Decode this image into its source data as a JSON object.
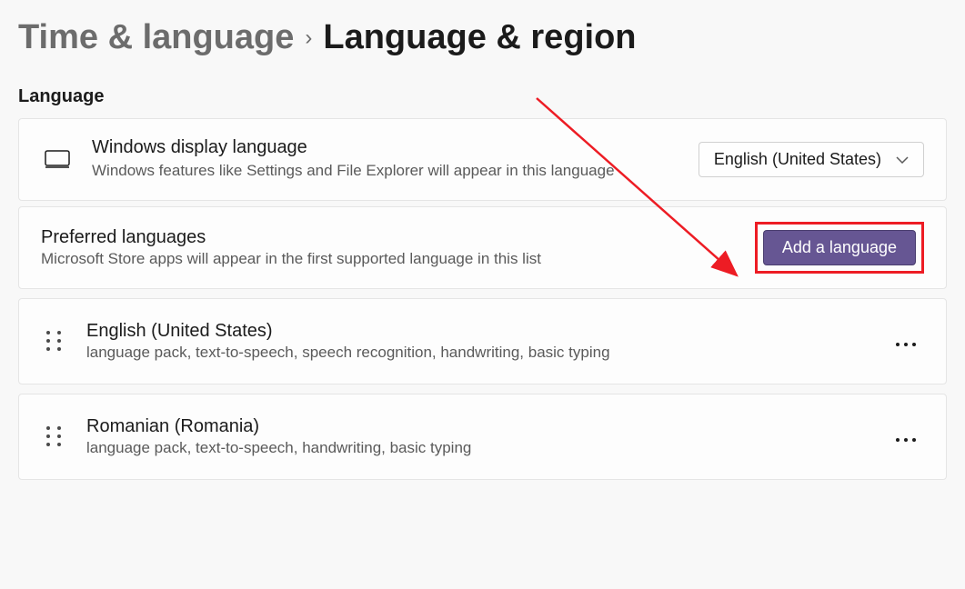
{
  "breadcrumb": {
    "parent": "Time & language",
    "current": "Language & region"
  },
  "section": {
    "title": "Language"
  },
  "displayLanguage": {
    "title": "Windows display language",
    "subtitle": "Windows features like Settings and File Explorer will appear in this language",
    "selected": "English (United States)"
  },
  "preferred": {
    "title": "Preferred languages",
    "subtitle": "Microsoft Store apps will appear in the first supported language in this list",
    "addButton": "Add a language"
  },
  "languages": [
    {
      "name": "English (United States)",
      "features": "language pack, text-to-speech, speech recognition, handwriting, basic typing"
    },
    {
      "name": "Romanian (Romania)",
      "features": "language pack, text-to-speech, handwriting, basic typing"
    }
  ],
  "annotation": {
    "highlightColor": "#ed1c24",
    "accentColor": "#665693"
  }
}
